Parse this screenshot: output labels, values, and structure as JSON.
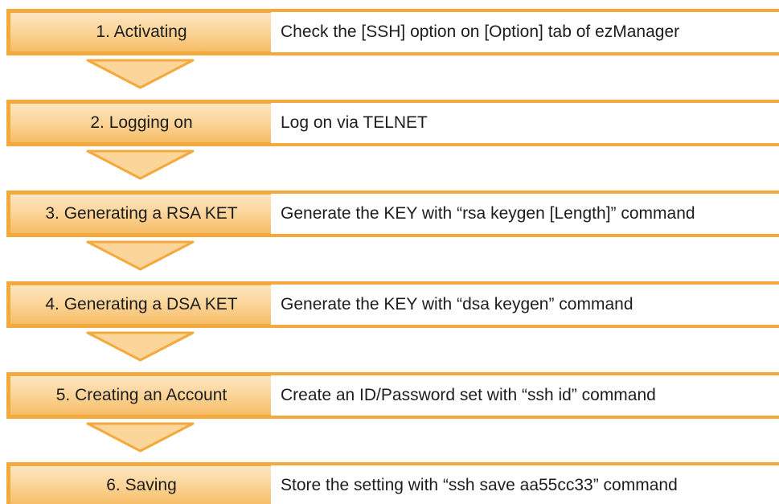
{
  "steps": [
    {
      "label": "1. Activating",
      "description": "Check the [SSH] option on [Option] tab of ezManager"
    },
    {
      "label": "2. Logging on",
      "description": "Log on via TELNET"
    },
    {
      "label": "3. Generating a RSA KET",
      "description": "Generate the KEY with “rsa keygen [Length]” command"
    },
    {
      "label": "4. Generating a DSA KET",
      "description": "Generate the KEY with “dsa keygen” command"
    },
    {
      "label": "5. Creating an Account",
      "description": "Create an ID/Password set with “ssh id” command"
    },
    {
      "label": "6. Saving",
      "description": "Store the setting with “ssh save aa55cc33” command"
    }
  ],
  "colors": {
    "border": "#f4a93d",
    "label_fill_top": "#fde6bf",
    "label_fill_bottom": "#f6bd66",
    "arrow_fill": "#fbd59a",
    "arrow_stroke": "#f4a93d"
  },
  "connector_icon": "chevron-down-arrow"
}
